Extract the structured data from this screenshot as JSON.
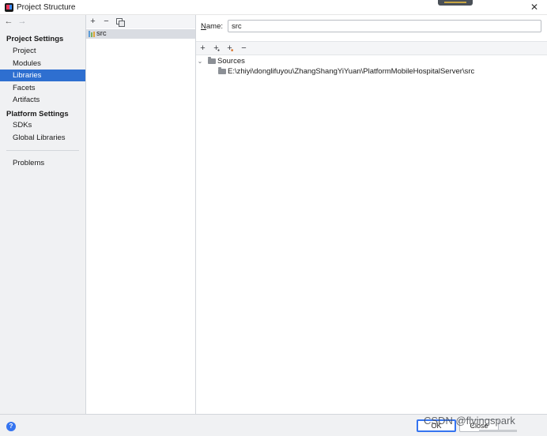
{
  "window": {
    "title": "Project Structure"
  },
  "nav": {
    "back_glyph": "←",
    "forward_glyph": "→"
  },
  "sidebar": {
    "project_settings": {
      "heading": "Project Settings",
      "items": [
        "Project",
        "Modules",
        "Libraries",
        "Facets",
        "Artifacts"
      ]
    },
    "platform_settings": {
      "heading": "Platform Settings",
      "items": [
        "SDKs",
        "Global Libraries"
      ]
    },
    "other_items": [
      "Problems"
    ],
    "selected": "Libraries"
  },
  "libraries": {
    "toolbar": {
      "add_glyph": "+",
      "remove_glyph": "−"
    },
    "items": [
      {
        "label": "src",
        "selected": true
      }
    ]
  },
  "detail": {
    "name_label_key": "N",
    "name_label_rest": "ame:",
    "name_value": "src",
    "toolbar": {
      "add_glyph": "+",
      "remove_glyph": "−"
    },
    "tree": {
      "root": {
        "label": "Sources",
        "expanded": true
      },
      "children": [
        "E:\\zhiyi\\donglifuyou\\ZhangShangYiYuan\\PlatformMobileHospitalServer\\src"
      ]
    }
  },
  "footer": {
    "help_glyph": "?",
    "ok_label": "OK",
    "close_label": "Close",
    "watermark": "CSDN @flyingspark"
  },
  "colors": {
    "accent": "#2e6fd0",
    "sidebar_bg": "#f0f1f3",
    "toolbar_bg": "#f4f5f7",
    "library_icon": [
      "#5c9bd6",
      "#7db35c",
      "#e0a53c"
    ]
  },
  "icons": {
    "app": "intellij-app-icon",
    "library": "library-bars-icon",
    "folder": "folder-icon",
    "help": "help-circle-icon"
  }
}
